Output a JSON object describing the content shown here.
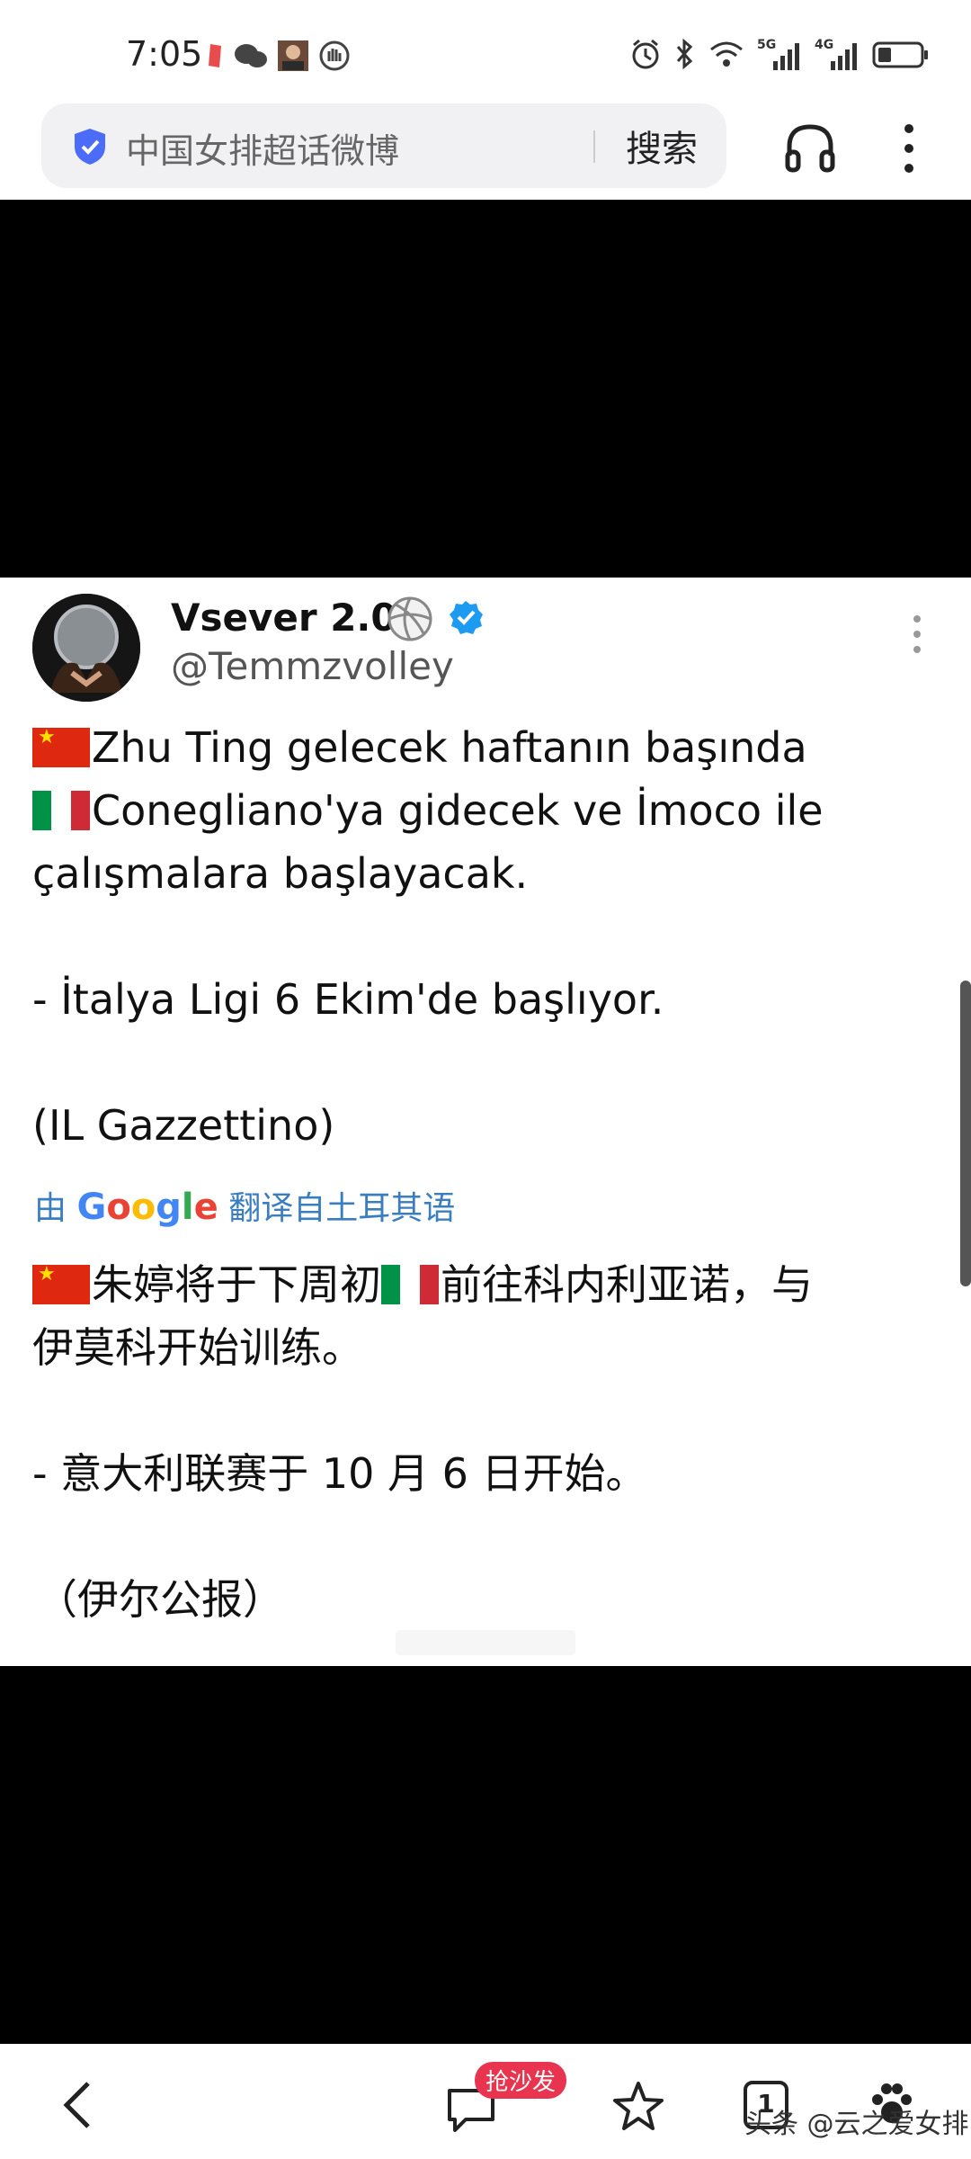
{
  "status_bar": {
    "time": "7:05",
    "network_1": "5G",
    "network_2": "4G"
  },
  "address_bar": {
    "query": "中国女排超话微博",
    "search_label": "搜索"
  },
  "tweet": {
    "display_name": "Vsever 2.0",
    "handle": "@Temmzvolley",
    "original_lines": [
      "Zhu Ting gelecek haftanın başında",
      "Conegliano'ya gidecek ve İmoco ile",
      "çalışmalara başlayacak.",
      "- İtalya Ligi 6 Ekim'de başlıyor.",
      "(IL Gazzettino)"
    ],
    "translate": {
      "prefix": "由",
      "brand": "Google",
      "suffix": "翻译自土耳其语"
    },
    "translated_lines": [
      "朱婷将于下周初",
      "前往科内利亚诺，与",
      "伊莫科开始训练。",
      "- 意大利联赛于 10 月 6 日开始。",
      "（伊尔公报）"
    ]
  },
  "nav_bar": {
    "sofa_badge": "抢沙发",
    "tab_count": "1",
    "watermark": "头条 @云之爱女排"
  },
  "colors": {
    "link_blue": "#3a7ec0",
    "verified_blue": "#1d9bf0",
    "badge_red": "#e8344e",
    "shield_blue": "#4a6cf7"
  }
}
